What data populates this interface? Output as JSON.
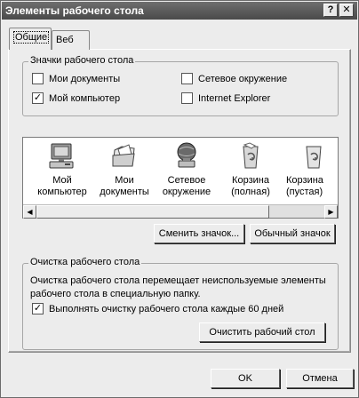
{
  "window": {
    "title": "Элементы рабочего стола",
    "help_label": "?",
    "close_label": "✕"
  },
  "tabs": [
    {
      "label": "Общие",
      "active": true
    },
    {
      "label": "Веб",
      "active": false
    }
  ],
  "desktop_icons": {
    "title": "Значки рабочего стола",
    "checkboxes": [
      {
        "label": "Мои документы",
        "checked": false
      },
      {
        "label": "Мой компьютер",
        "checked": true
      },
      {
        "label": "Сетевое окружение",
        "checked": false
      },
      {
        "label": "Internet Explorer",
        "checked": false
      }
    ]
  },
  "icon_list": {
    "items": [
      {
        "line1": "Мой",
        "line2": "компьютер",
        "icon": "computer-icon"
      },
      {
        "line1": "Мои",
        "line2": "документы",
        "icon": "documents-icon"
      },
      {
        "line1": "Сетевое",
        "line2": "окружение",
        "icon": "network-icon"
      },
      {
        "line1": "Корзина",
        "line2": "(полная)",
        "icon": "recycle-bin-full-icon"
      },
      {
        "line1": "Корзина",
        "line2": "(пустая)",
        "icon": "recycle-bin-empty-icon"
      }
    ],
    "scroll_left": "◀",
    "scroll_right": "▶"
  },
  "icon_buttons": {
    "change_icon": "Сменить значок...",
    "default_icon": "Обычный значок"
  },
  "cleanup": {
    "title": "Очистка рабочего стола",
    "description": "Очистка рабочего стола перемещает неиспользуемые элементы рабочего стола в специальную папку.",
    "checkbox_label": "Выполнять очистку рабочего стола каждые 60 дней",
    "checkbox_checked": true,
    "clean_button": "Очистить рабочий стол"
  },
  "footer": {
    "ok": "OK",
    "cancel": "Отмена"
  }
}
